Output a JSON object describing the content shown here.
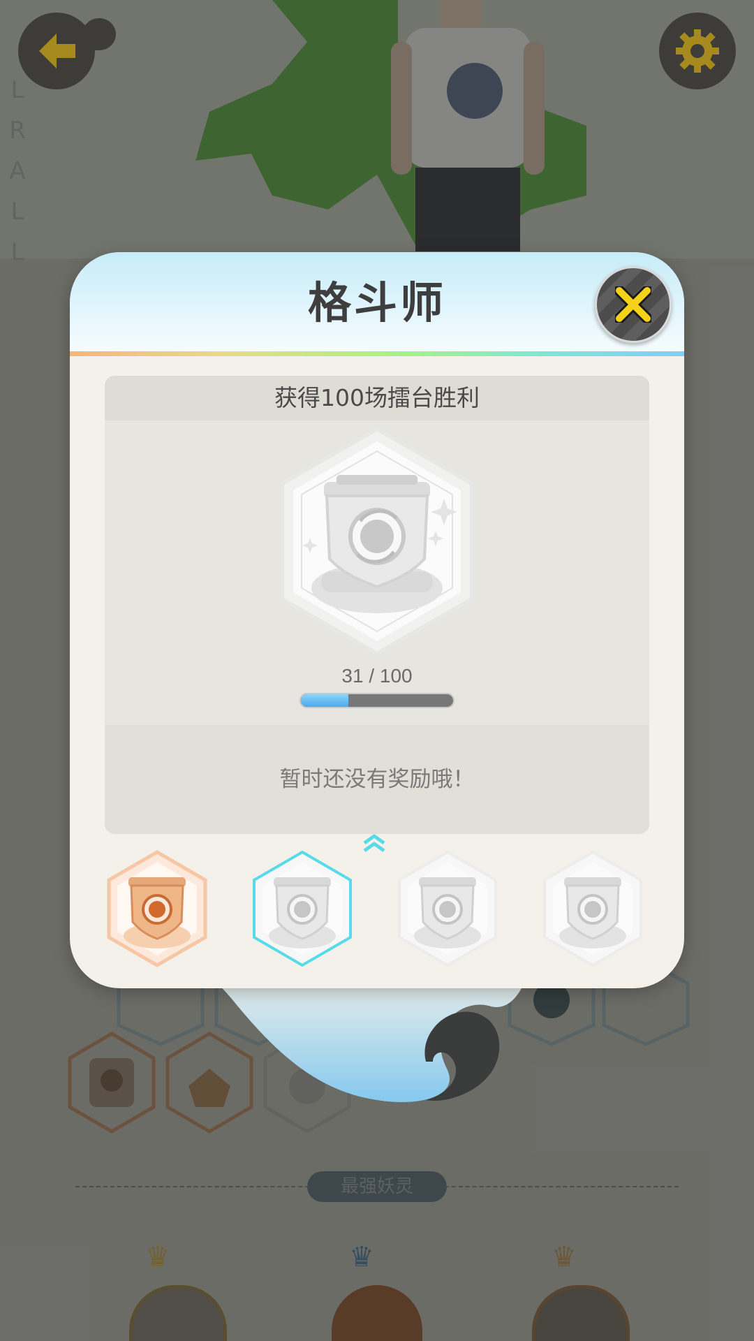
{
  "background": {
    "side_letters": [
      "L",
      "R",
      "A",
      "L",
      "L"
    ],
    "section_title": "最强妖灵",
    "back_icon": "arrow-left-icon",
    "settings_icon": "gear-icon"
  },
  "modal": {
    "title": "格斗师",
    "close_icon": "close-x-icon",
    "requirement": "获得100场擂台胜利",
    "progress": {
      "text": "31 / 100",
      "current": 31,
      "total": 100
    },
    "reward_text": "暂时还没有奖励哦！",
    "tiers": [
      {
        "name": "bronze",
        "state": "unlocked",
        "color": "#e59a5a"
      },
      {
        "name": "silver",
        "state": "selected",
        "color": "#58dbe8"
      },
      {
        "name": "gold",
        "state": "locked",
        "color": "#ececec"
      },
      {
        "name": "diamond",
        "state": "locked",
        "color": "#ececec"
      }
    ]
  },
  "colors": {
    "accent_yellow": "#f4d21a",
    "progress_blue": "#4aa9ee",
    "selected_cyan": "#58dbe8"
  }
}
